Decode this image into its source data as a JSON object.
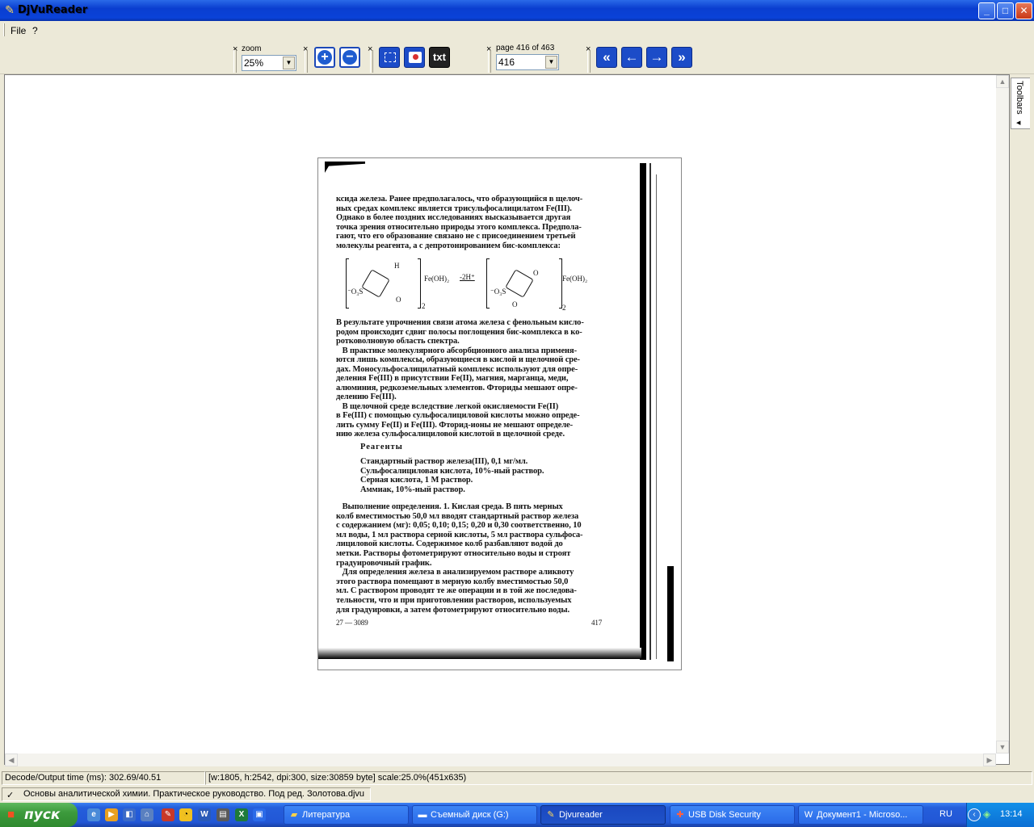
{
  "window": {
    "title": "DjVuReader",
    "icon": "djvu-icon"
  },
  "menu": {
    "file": "File",
    "help": "?"
  },
  "toolbar": {
    "zoom_label": "zoom",
    "zoom_value": "25%",
    "page_label": "page 416 of 463",
    "page_value": "416",
    "text_button": "txt",
    "close_glyph": "×"
  },
  "side_tab": {
    "label": "Toolbars"
  },
  "document": {
    "para1": [
      "ксида железа. Ранее предполагалось, что образующийся в щелоч-",
      "ных средах комплекс является трисульфосалицилатом Fe(III).",
      "Однако в более поздних исследованиях высказывается другая",
      "точка зрения относительно природы этого комплекса. Предпола-",
      "гают, что его образование связано не с присоединением третьей",
      "молекулы реагента, а с депротонированием бис-комплекса:"
    ],
    "chem": {
      "left_ligand": "Fe(OH)₂",
      "arrow": "-2H⁺",
      "right_ligand": "Fe(OH)₂",
      "so3": "⁻O₃S",
      "sub": "2",
      "h": "H",
      "o": "O"
    },
    "para2": [
      "В результате упрочнения связи атома железа с фенольным кисло-",
      "родом происходит сдвиг полосы поглощения бис-комплекса в ко-",
      "ротковолновую область спектра.",
      "   В практике молекулярного абсорбционного анализа применя-",
      "ются лишь комплексы, образующиеся в кислой и щелочной сре-",
      "дах. Моносульфосалицилатный комплекс используют для опре-",
      "деления Fe(III) в присутствии Fe(II), магния, марганца, меди,",
      "алюминия, редкоземельных элементов. Фториды мешают опре-",
      "делению Fe(III).",
      "   В щелочной среде вследствие легкой окисляемости Fe(II)",
      "в Fe(III) с помощью сульфосалициловой кислоты можно опреде-",
      "лить сумму Fe(II) и Fe(III). Фторид-ионы не мешают определе-",
      "нию железа сульфосалициловой кислотой в щелочной среде."
    ],
    "reagents_heading": "Реагенты",
    "reagents": [
      "Стандартный раствор железа(III), 0,1 мг/мл.",
      "Сульфосалициловая кислота, 10%-ный раствор.",
      "Серная кислота, 1 М раствор.",
      "Аммиак, 10%-ный раствор."
    ],
    "para3": [
      "   Выполнение определения. 1. Кислая среда. В пять мерных",
      "колб вместимостью 50,0 мл вводят стандартный раствор железа",
      "с содержанием (мг): 0,05; 0,10; 0,15; 0,20 и 0,30 соответственно, 10",
      "мл воды, 1 мл раствора серной кислоты, 5 мл раствора сульфоса-",
      "лициловой кислоты. Содержимое колб разбавляют водой до",
      "метки. Растворы фотометрируют относительно воды и строят",
      "градуировочный график.",
      "   Для определения железа в анализируемом растворе аликвоту",
      "этого раствора помещают в мерную колбу вместимостью 50,0",
      "мл. С раствором проводят те же операции и в той же последова-",
      "тельности, что и при приготовлении растворов, используемых",
      "для градуировки, а затем фотометрируют относительно воды."
    ],
    "footer_left": "27 — 3089",
    "footer_right": "417"
  },
  "status": {
    "decode": "Decode/Output time (ms): 302.69/40.51",
    "info": "[w:1805, h:2542, dpi:300, size:30859 byte] scale:25.0%(451x635)",
    "file": "Основы аналитической химии. Практическое руководство. Под ред. Золотова.djvu"
  },
  "taskbar": {
    "start": "пуск",
    "tasks": [
      "Литература",
      "Съемный диск (G:)",
      "Djvureader",
      "USB Disk Security",
      "Документ1 - Microso..."
    ],
    "lang": "RU",
    "clock": "13:14"
  },
  "colors": {
    "title_bar": "#0a3ed0",
    "taskbar": "#245edb",
    "start": "#3c9a3c",
    "nav_button": "#1c4cc8"
  }
}
